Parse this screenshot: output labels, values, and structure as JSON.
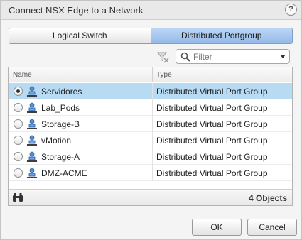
{
  "dialog": {
    "title": "Connect NSX Edge to a Network",
    "help_icon": "question-mark-icon",
    "help_glyph": "?"
  },
  "toggle": {
    "left_label": "Logical Switch",
    "right_label": "Distributed Portgroup",
    "selected": "Distributed Portgroup"
  },
  "filter": {
    "placeholder": "Filter",
    "value": ""
  },
  "grid": {
    "columns": {
      "name": "Name",
      "type": "Type"
    },
    "rows": [
      {
        "name": "Servidores",
        "type": "Distributed Virtual Port Group",
        "selected": true
      },
      {
        "name": "Lab_Pods",
        "type": "Distributed Virtual Port Group",
        "selected": false
      },
      {
        "name": "Storage-B",
        "type": "Distributed Virtual Port Group",
        "selected": false
      },
      {
        "name": "vMotion",
        "type": "Distributed Virtual Port Group",
        "selected": false
      },
      {
        "name": "Storage-A",
        "type": "Distributed Virtual Port Group",
        "selected": false
      },
      {
        "name": "DMZ-ACME",
        "type": "Distributed Virtual Port Group",
        "selected": false
      }
    ],
    "footer_count": "4 Objects"
  },
  "buttons": {
    "ok": "OK",
    "cancel": "Cancel"
  },
  "colors": {
    "selected_row": "#b8dbf4",
    "toggle_active": "#93b9e8"
  }
}
